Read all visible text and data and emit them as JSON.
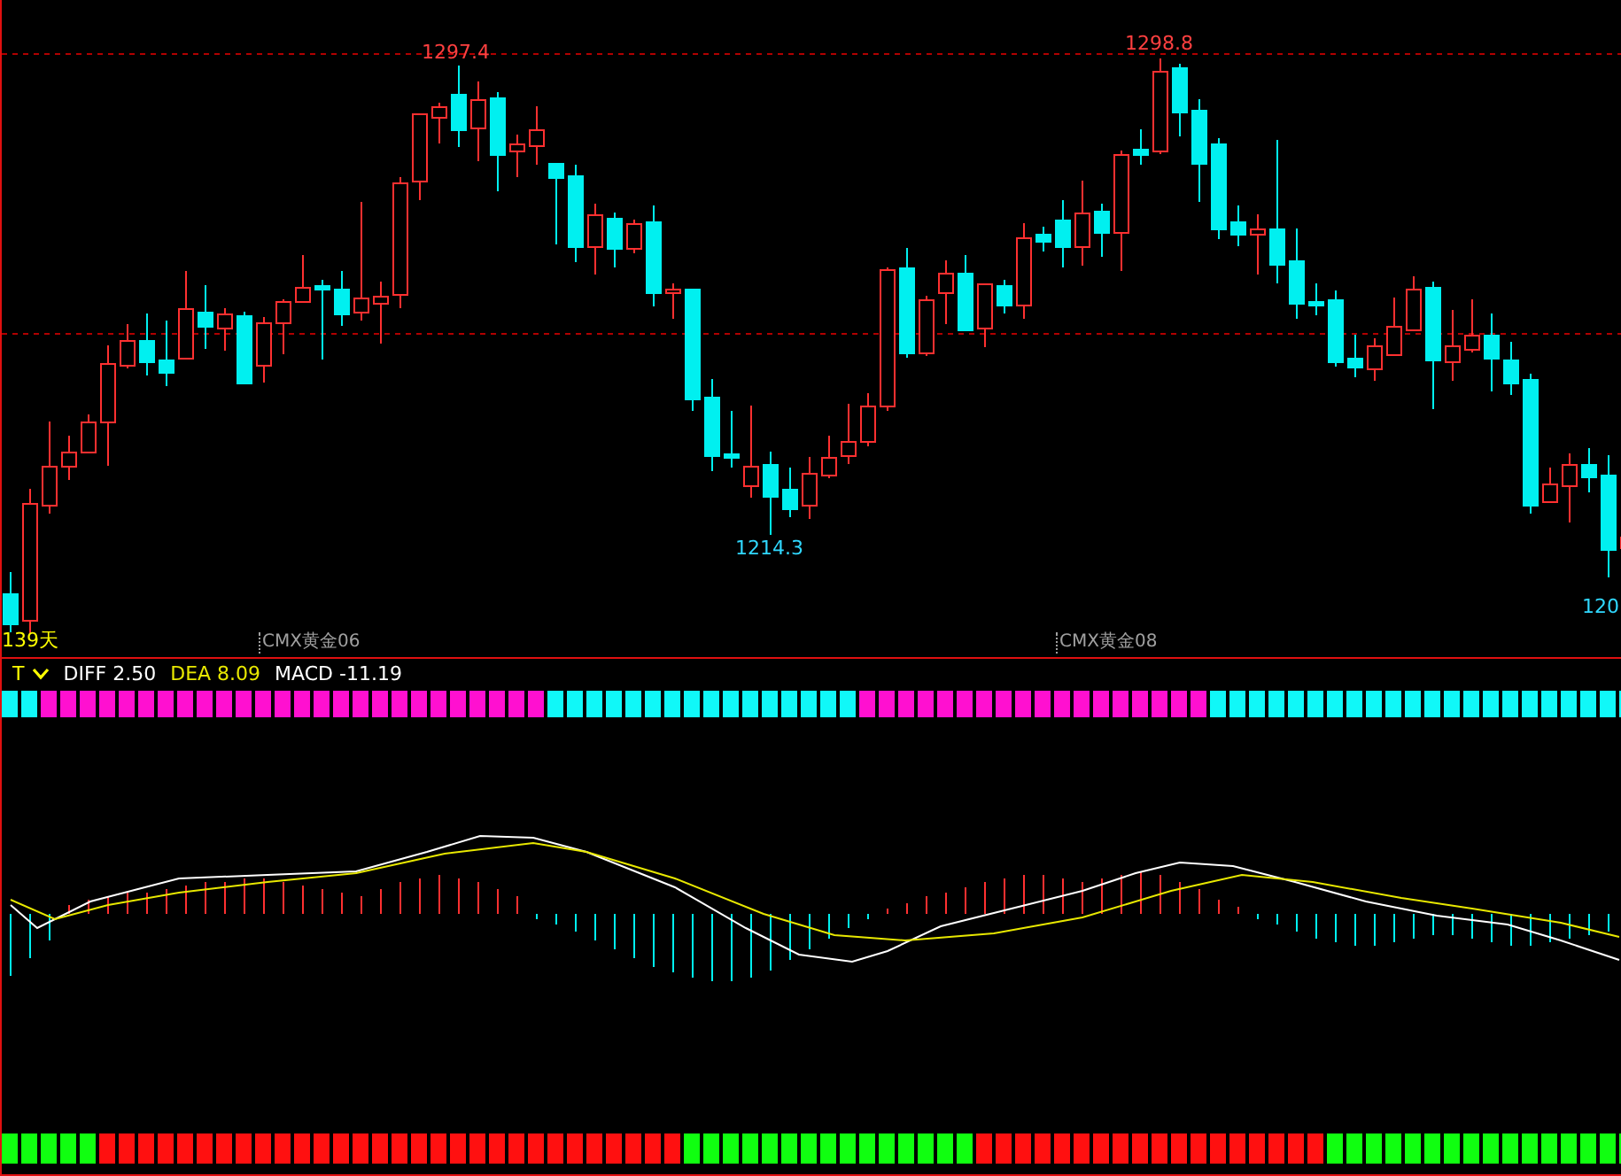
{
  "price_chart": {
    "price_labels": [
      {
        "text": "1297.4",
        "kind": "high"
      },
      {
        "text": "1298.8",
        "kind": "high"
      },
      {
        "text": "1214.3",
        "kind": "low"
      },
      {
        "text": "120",
        "kind": "low"
      }
    ],
    "period": "139天",
    "contracts": [
      "CMX黄金06",
      "CMX黄金08"
    ]
  },
  "indicator": {
    "name": "T",
    "values": [
      {
        "label": "DIFF 2.50",
        "kind": "diff"
      },
      {
        "label": "DEA 8.09",
        "kind": "dea"
      },
      {
        "label": "MACD -11.19",
        "kind": "macd"
      }
    ]
  }
}
